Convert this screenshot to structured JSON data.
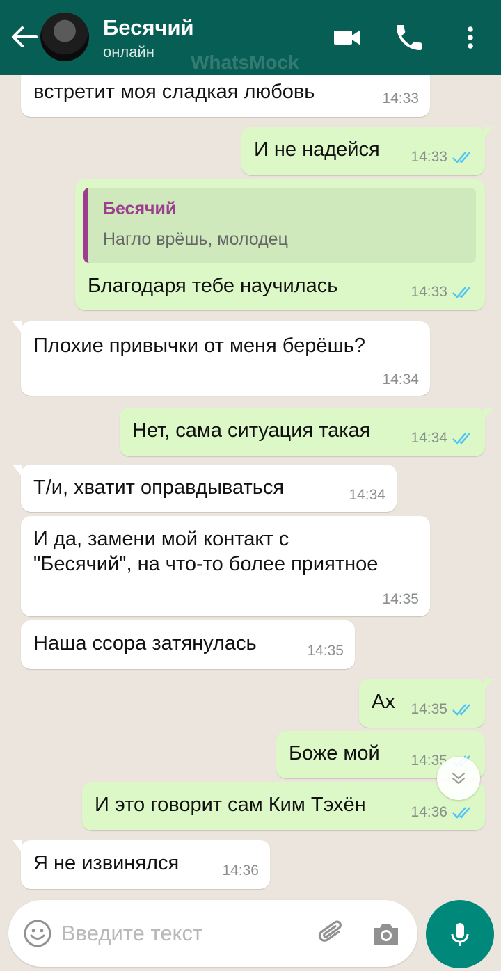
{
  "header": {
    "contact_name": "Бесячий",
    "status": "онлайн",
    "watermark": "WhatsMock"
  },
  "colors": {
    "header": "#075e54",
    "outgoing_bubble": "#dcf8c6",
    "incoming_bubble": "#ffffff",
    "read_ticks": "#4fc3f7",
    "mic_button": "#00897b",
    "quote_author": "#9c3d8f"
  },
  "messages": [
    {
      "direction": "in",
      "text": "встретит моя сладкая любовь",
      "time": "14:33"
    },
    {
      "direction": "out",
      "text": "И не надейся",
      "time": "14:33",
      "read": true
    },
    {
      "direction": "out",
      "quote_author": "Бесячий",
      "quote_text": "Нагло врёшь, молодец",
      "text": "Благодаря тебе научилась",
      "time": "14:33",
      "read": true
    },
    {
      "direction": "in",
      "text": "Плохие привычки от меня берёшь?",
      "time": "14:34"
    },
    {
      "direction": "out",
      "text": "Нет, сама ситуация такая",
      "time": "14:34",
      "read": true
    },
    {
      "direction": "in",
      "text": "Т/и, хватит оправдываться",
      "time": "14:34"
    },
    {
      "direction": "in",
      "lines": [
        "И да, замени мой контакт с",
        "\"Бесячий\", на что-то более приятное"
      ],
      "time": "14:35"
    },
    {
      "direction": "in",
      "text": "Наша ссора затянулась",
      "time": "14:35"
    },
    {
      "direction": "out",
      "text": "Ах",
      "time": "14:35",
      "read": true
    },
    {
      "direction": "out",
      "text": "Боже мой",
      "time": "14:35",
      "read": true
    },
    {
      "direction": "out",
      "text": "И это говорит сам Ким Тэхён",
      "time": "14:36",
      "read": true
    },
    {
      "direction": "in",
      "text": "Я не извинялся",
      "time": "14:36"
    }
  ],
  "input": {
    "placeholder": "Введите текст"
  },
  "icons": [
    "back-arrow-icon",
    "video-call-icon",
    "phone-icon",
    "more-vert-icon",
    "double-check-icon",
    "chevron-down-icon",
    "emoji-icon",
    "paperclip-icon",
    "camera-icon",
    "mic-icon"
  ]
}
